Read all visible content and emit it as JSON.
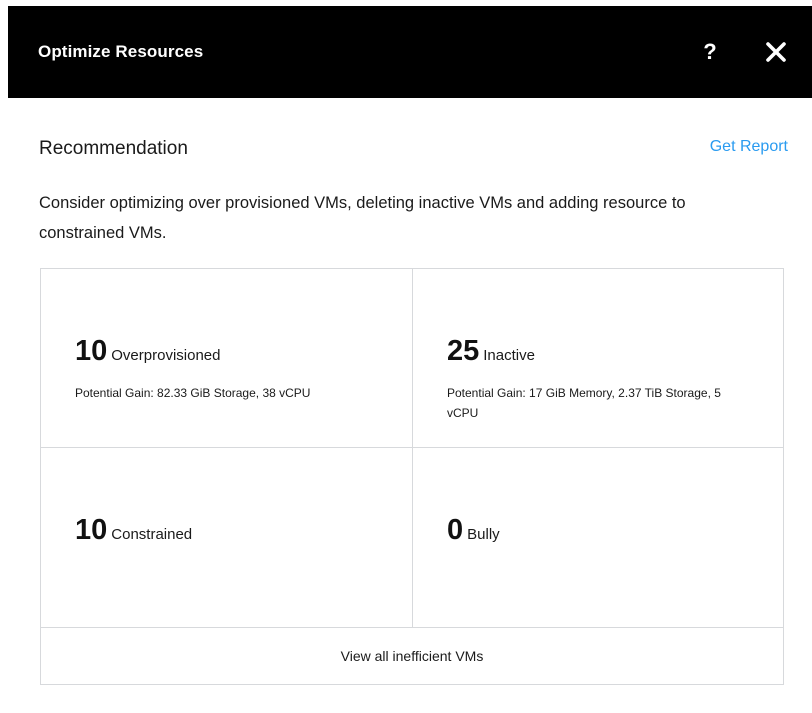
{
  "dialog": {
    "title": "Optimize Resources",
    "help_icon": "question-mark-icon",
    "close_icon": "close-icon",
    "header_background": "#000000"
  },
  "recommendation": {
    "heading": "Recommendation",
    "report_link": "Get Report",
    "link_color": "#2a9bf0",
    "description": "Consider optimizing over provisioned VMs, deleting inactive VMs and adding resource to constrained VMs."
  },
  "stats": [
    {
      "count": "10",
      "label": "Overprovisioned",
      "gain": "Potential Gain: 82.33 GiB Storage, 38 vCPU"
    },
    {
      "count": "25",
      "label": "Inactive",
      "gain": "Potential Gain: 17 GiB Memory, 2.37 TiB Storage, 5 vCPU"
    },
    {
      "count": "10",
      "label": "Constrained"
    },
    {
      "count": "0",
      "label": "Bully"
    }
  ],
  "footer": {
    "link_label": "View all inefficient VMs"
  }
}
